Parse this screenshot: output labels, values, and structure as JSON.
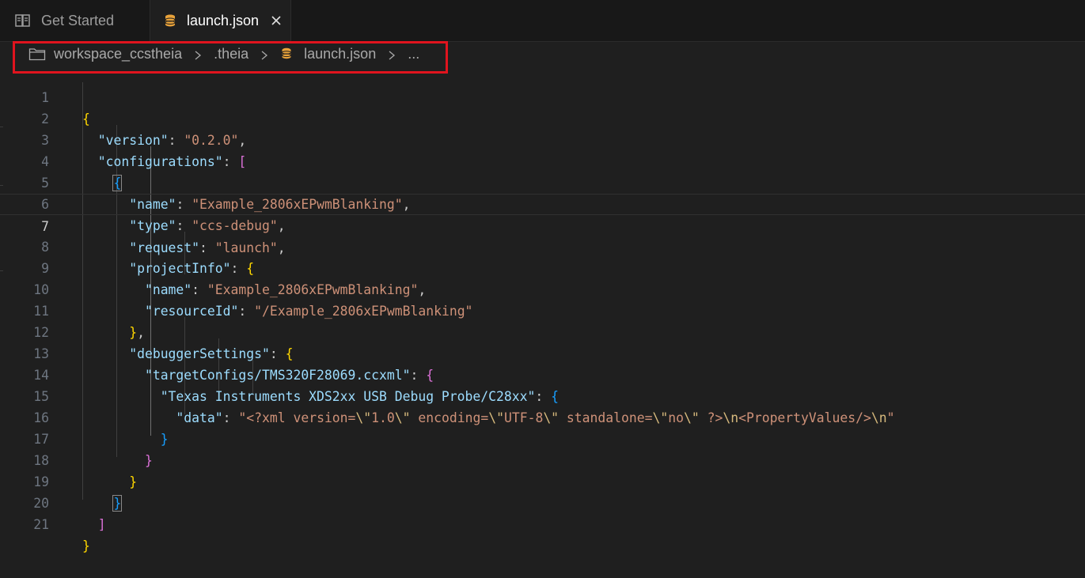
{
  "tabs": [
    {
      "label": "Get Started",
      "icon": "book-icon",
      "active": false
    },
    {
      "label": "launch.json",
      "icon": "json-file-icon",
      "active": true
    }
  ],
  "breadcrumb": {
    "items": [
      "workspace_ccstheia",
      ".theia",
      "launch.json",
      "..."
    ]
  },
  "editor": {
    "current_line": 7,
    "lines": [
      {
        "n": "1"
      },
      {
        "n": "2"
      },
      {
        "n": "3"
      },
      {
        "n": "4"
      },
      {
        "n": "5"
      },
      {
        "n": "6"
      },
      {
        "n": "7"
      },
      {
        "n": "8"
      },
      {
        "n": "9"
      },
      {
        "n": "10"
      },
      {
        "n": "11"
      },
      {
        "n": "12"
      },
      {
        "n": "13"
      },
      {
        "n": "14"
      },
      {
        "n": "15"
      },
      {
        "n": "16"
      },
      {
        "n": "17"
      },
      {
        "n": "18"
      },
      {
        "n": "19"
      },
      {
        "n": "20"
      },
      {
        "n": "21"
      }
    ],
    "tokens": {
      "version_key": "\"version\"",
      "version_val": "\"0.2.0\"",
      "configurations_key": "\"configurations\"",
      "name_key": "\"name\"",
      "name_val": "\"Example_2806xEPwmBlanking\"",
      "type_key": "\"type\"",
      "type_val": "\"ccs-debug\"",
      "request_key": "\"request\"",
      "request_val": "\"launch\"",
      "projectInfo_key": "\"projectInfo\"",
      "pi_name_key": "\"name\"",
      "pi_name_val": "\"Example_2806xEPwmBlanking\"",
      "resourceId_key": "\"resourceId\"",
      "resourceId_val": "\"/Example_2806xEPwmBlanking\"",
      "debuggerSettings_key": "\"debuggerSettings\"",
      "targetConfigs_key": "\"targetConfigs/TMS320F28069.ccxml\"",
      "probe_key": "\"Texas Instruments XDS2xx USB Debug Probe/C28xx\"",
      "data_key": "\"data\"",
      "data_val_a": "\"<?xml version=",
      "data_esc_1": "\\\"",
      "data_val_b": "1.0",
      "data_esc_2": "\\\"",
      "data_val_c": " encoding=",
      "data_esc_3": "\\\"",
      "data_val_d": "UTF-8",
      "data_esc_4": "\\\"",
      "data_val_e": " standalone=",
      "data_esc_5": "\\\"",
      "data_val_f": "no",
      "data_esc_6": "\\\"",
      "data_val_g": " ?>",
      "data_esc_7": "\\n",
      "data_val_h": "<PropertyValues/>",
      "data_esc_8": "\\n",
      "data_val_i": "\""
    }
  },
  "colors": {
    "accent_highlight": "#e0141e",
    "key": "#9cdcfe",
    "string": "#ce9178",
    "bracket_level1": "#ffd700",
    "bracket_level2": "#da70d6",
    "bracket_level3": "#179fff"
  }
}
